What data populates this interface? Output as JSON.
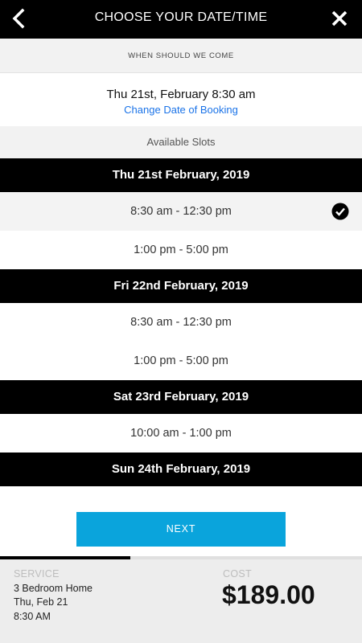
{
  "header": {
    "title": "CHOOSE YOUR DATE/TIME",
    "back_icon": "chevron-left-icon",
    "close_icon": "close-icon"
  },
  "when": {
    "label": "WHEN SHOULD WE COME"
  },
  "selection": {
    "datetime": "Thu 21st, February 8:30 am",
    "change_link": "Change Date of Booking"
  },
  "available": {
    "label": "Available Slots"
  },
  "days": [
    {
      "label": "Thu 21st February, 2019",
      "slots": [
        {
          "label": "8:30 am - 12:30 pm",
          "selected": true
        },
        {
          "label": "1:00 pm - 5:00 pm",
          "selected": false
        }
      ]
    },
    {
      "label": "Fri 22nd February, 2019",
      "slots": [
        {
          "label": "8:30 am - 12:30 pm",
          "selected": false
        },
        {
          "label": "1:00 pm - 5:00 pm",
          "selected": false
        }
      ]
    },
    {
      "label": "Sat 23rd February, 2019",
      "slots": [
        {
          "label": "10:00 am - 1:00 pm",
          "selected": false
        }
      ]
    },
    {
      "label": "Sun 24th February, 2019",
      "slots": []
    }
  ],
  "next_button": {
    "label": "NEXT"
  },
  "progress": {
    "fraction": 0.36
  },
  "summary": {
    "service_label": "SERVICE",
    "service_lines": [
      "3 Bedroom Home",
      "Thu, Feb 21",
      "8:30 AM"
    ],
    "cost_label": "COST",
    "cost": "$189.00"
  },
  "colors": {
    "accent": "#0aa4dc",
    "link": "#1a73e8",
    "header_bg": "#000000"
  }
}
